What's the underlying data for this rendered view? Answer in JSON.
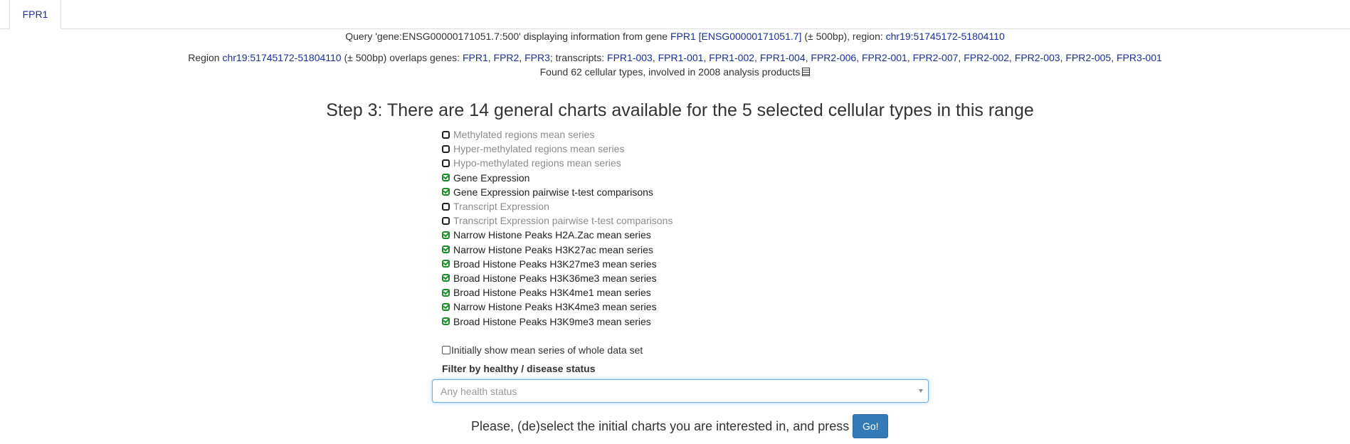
{
  "tab": {
    "label": "FPR1"
  },
  "query": {
    "prefix": "Query 'gene:ENSG00000171051.7:500' displaying information from gene ",
    "gene_link": "FPR1",
    "ensg_link": "[ENSG00000171051.7]",
    "middle": " (± 500bp), region: ",
    "region_link": "chr19:51745172-51804110"
  },
  "overlaps": {
    "prefix": "Region ",
    "region_link": "chr19:51745172-51804110",
    "middle": " (± 500bp) overlaps genes: ",
    "genes": [
      "FPR1",
      "FPR2",
      "FPR3"
    ],
    "transcripts_label": "; transcripts: ",
    "transcripts": [
      "FPR1-003",
      "FPR1-001",
      "FPR1-002",
      "FPR1-004",
      "FPR2-006",
      "FPR2-001",
      "FPR2-007",
      "FPR2-002",
      "FPR2-003",
      "FPR2-005",
      "FPR3-001"
    ]
  },
  "found": {
    "text": "Found 62 cellular types, involved in 2008 analysis products",
    "icon": "table-icon"
  },
  "step_title": "Step 3: There are 14 general charts available for the 5 selected cellular types in this range",
  "charts": [
    {
      "label": "Methylated regions mean series",
      "checked": false
    },
    {
      "label": "Hyper-methylated regions mean series",
      "checked": false
    },
    {
      "label": "Hypo-methylated regions mean series",
      "checked": false
    },
    {
      "label": "Gene Expression",
      "checked": true
    },
    {
      "label": "Gene Expression pairwise t-test comparisons",
      "checked": true
    },
    {
      "label": "Transcript Expression",
      "checked": false
    },
    {
      "label": "Transcript Expression pairwise t-test comparisons",
      "checked": false
    },
    {
      "label": "Narrow Histone Peaks H2A.Zac mean series",
      "checked": true
    },
    {
      "label": "Narrow Histone Peaks H3K27ac mean series",
      "checked": true
    },
    {
      "label": "Broad Histone Peaks H3K27me3 mean series",
      "checked": true
    },
    {
      "label": "Broad Histone Peaks H3K36me3 mean series",
      "checked": true
    },
    {
      "label": "Broad Histone Peaks H3K4me1 mean series",
      "checked": true
    },
    {
      "label": "Narrow Histone Peaks H3K4me3 mean series",
      "checked": true
    },
    {
      "label": "Broad Histone Peaks H3K9me3 mean series",
      "checked": true
    }
  ],
  "initial_mean": {
    "label": "Initially show mean series of whole data set",
    "checked": false
  },
  "filter": {
    "label": "Filter by healthy / disease status",
    "placeholder": "Any health status"
  },
  "bottom": {
    "text": "Please, (de)select the initial charts you are interested in, and press",
    "go_label": "Go!"
  },
  "colors": {
    "link": "#1a2f9a",
    "check": "#1e8c2e",
    "go_button": "#337ab7",
    "focus_border": "#66afe9"
  }
}
